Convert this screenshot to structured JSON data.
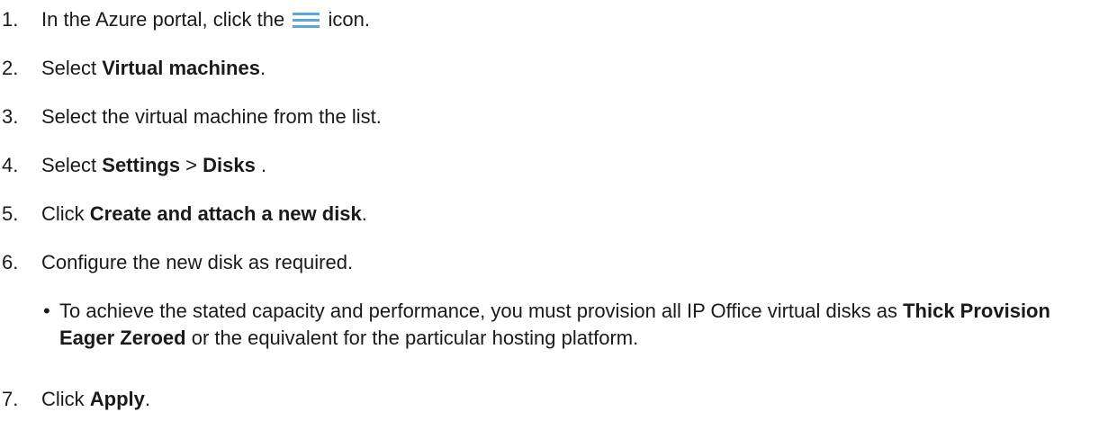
{
  "steps": [
    {
      "num": "1.",
      "pre": "In the Azure portal, click the",
      "icon": "hamburger-menu-icon",
      "post": "icon."
    },
    {
      "num": "2.",
      "pre": "Select ",
      "bold": "Virtual machines",
      "post": "."
    },
    {
      "num": "3.",
      "text": "Select the virtual machine from the list."
    },
    {
      "num": "4.",
      "pre": "Select ",
      "bold1": "Settings",
      "mid": " > ",
      "bold2": "Disks",
      "post": " ."
    },
    {
      "num": "5.",
      "pre": "Click ",
      "bold": "Create and attach a new disk",
      "post": "."
    },
    {
      "num": "6.",
      "text": "Configure the new disk as required."
    },
    {
      "num": "7.",
      "pre": "Click ",
      "bold": "Apply",
      "post": "."
    }
  ],
  "substep": {
    "bullet": "•",
    "pre": "To achieve the stated capacity and performance, you must provision all IP Office virtual disks as ",
    "bold": "Thick Provision Eager Zeroed",
    "post": " or the equivalent for the particular hosting platform."
  },
  "colors": {
    "text": "#1a1a1a",
    "icon": "#5aa7e0"
  }
}
